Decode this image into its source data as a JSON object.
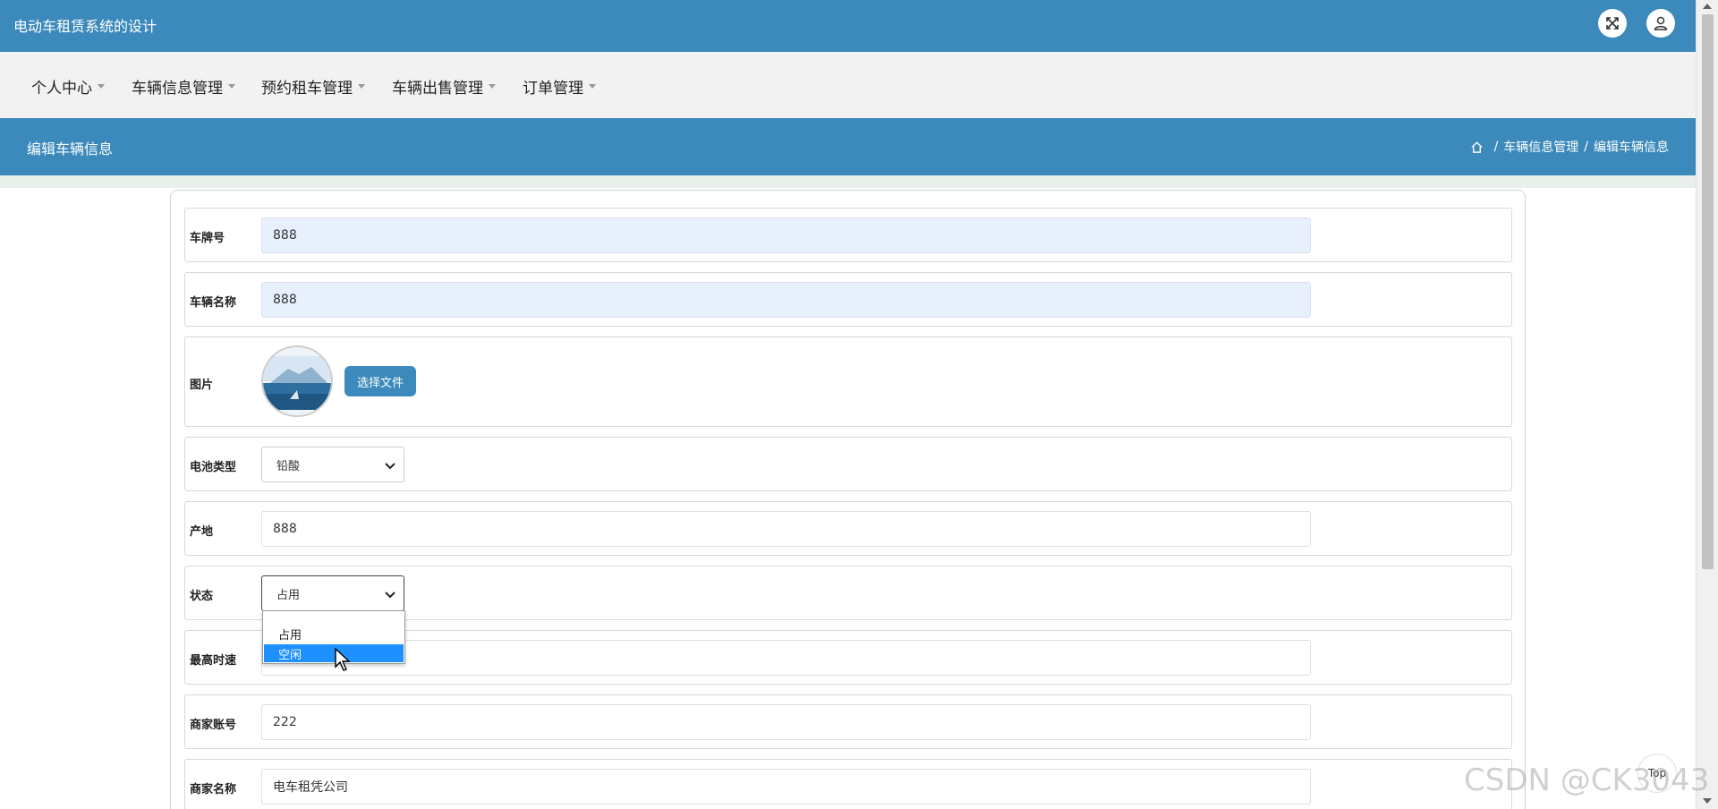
{
  "app": {
    "title": "电动车租赁系统的设计"
  },
  "nav": {
    "items": [
      {
        "label": "个人中心"
      },
      {
        "label": "车辆信息管理"
      },
      {
        "label": "预约租车管理"
      },
      {
        "label": "车辆出售管理"
      },
      {
        "label": "订单管理"
      }
    ]
  },
  "header": {
    "page_title": "编辑车辆信息",
    "breadcrumb": [
      "车辆信息管理",
      "编辑车辆信息"
    ],
    "separator": "/"
  },
  "form": {
    "plate": {
      "label": "车牌号",
      "value": "888"
    },
    "name": {
      "label": "车辆名称",
      "value": "888"
    },
    "image": {
      "label": "图片",
      "button": "选择文件"
    },
    "battery": {
      "label": "电池类型",
      "value": "铅酸"
    },
    "origin": {
      "label": "产地",
      "value": "888"
    },
    "status": {
      "label": "状态",
      "value": "占用",
      "options": [
        "占用",
        "空闲"
      ],
      "highlighted": "空闲"
    },
    "max_speed": {
      "label": "最高时速",
      "value": ""
    },
    "merchant_acc": {
      "label": "商家账号",
      "value": "222"
    },
    "merchant_name": {
      "label": "商家名称",
      "value": "电车租凭公司"
    }
  },
  "widgets": {
    "top_button": "Top"
  },
  "watermark": "CSDN @CK3043",
  "colors": {
    "primary": "#3c8abb",
    "autofill": "#e8f0fe",
    "option_highlight": "#1e90ff"
  }
}
